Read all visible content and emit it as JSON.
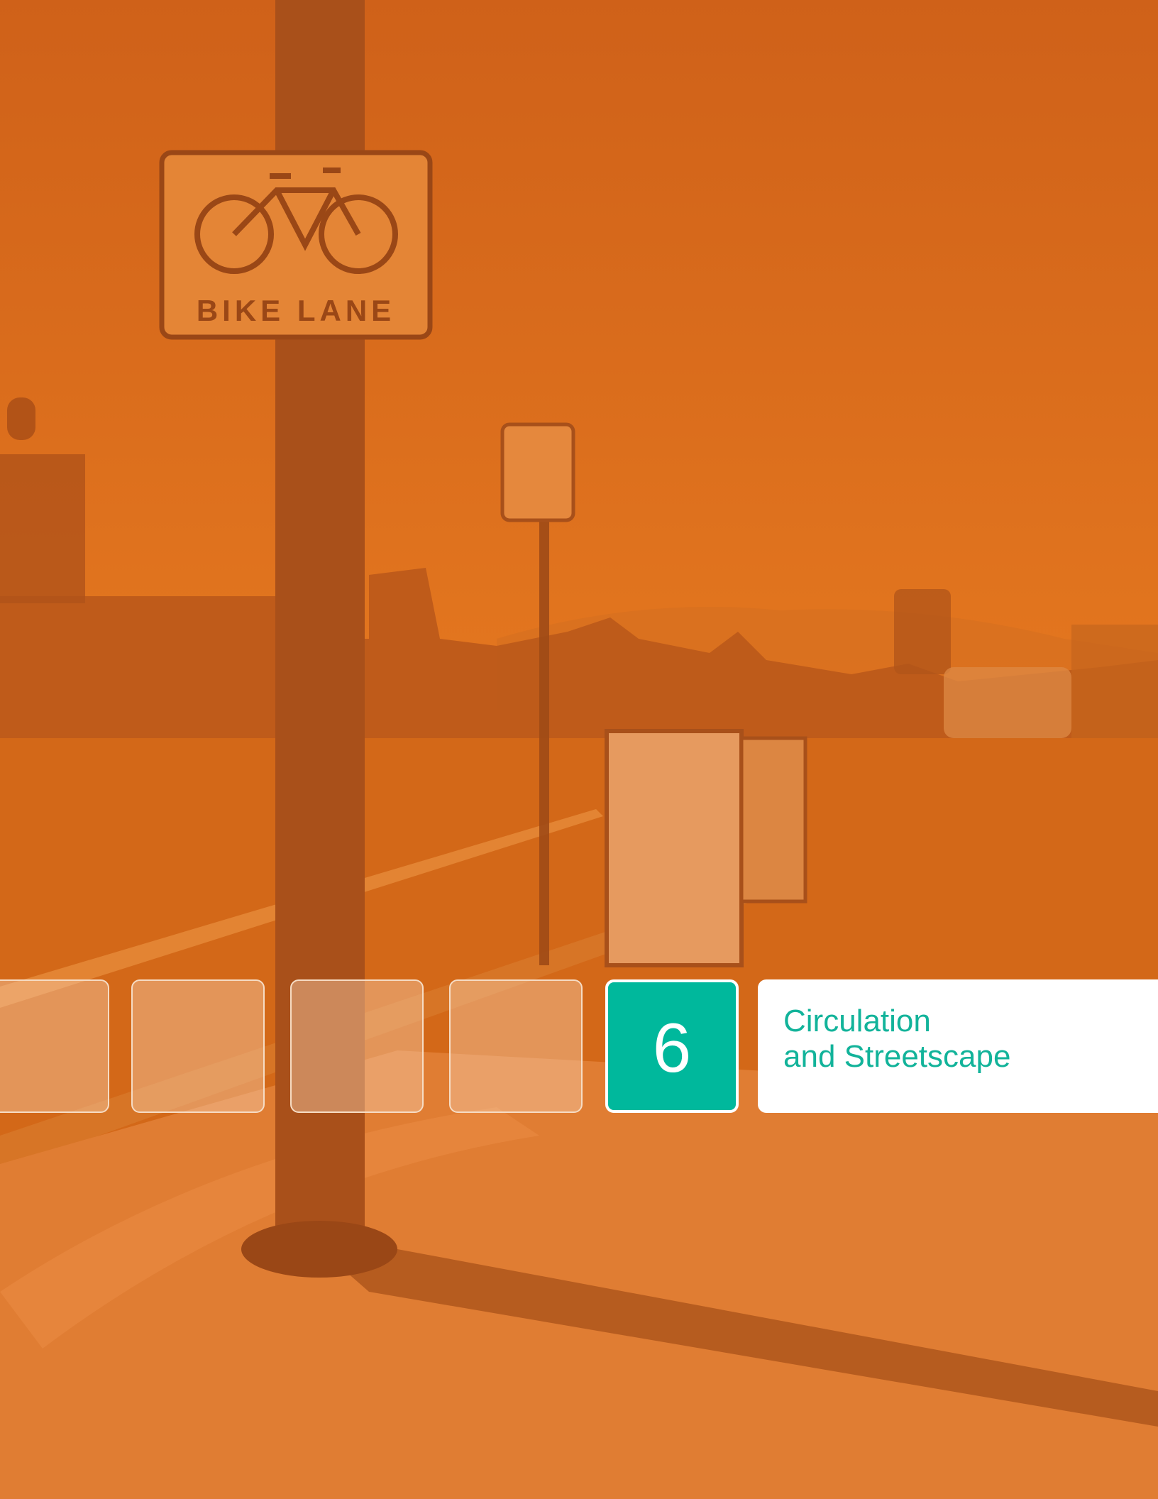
{
  "sign": {
    "text": "BIKE LANE"
  },
  "chapter": {
    "number": "6",
    "title_line_1": "Circulation",
    "title_line_2": "and Streetscape"
  },
  "colors": {
    "photo_tint": "#d96c1e",
    "accent": "#00b89c",
    "title_text": "#12b39a"
  }
}
